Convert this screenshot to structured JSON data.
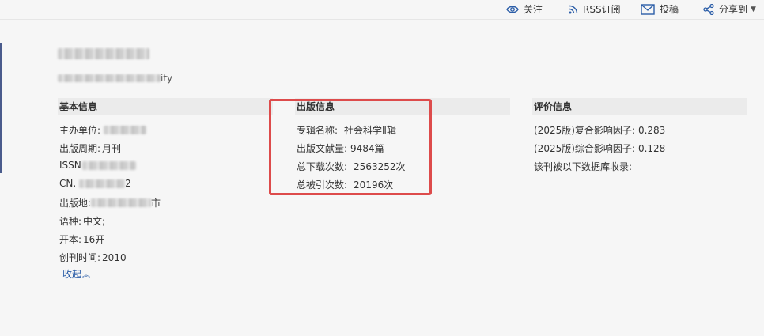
{
  "toolbar": {
    "follow": "关注",
    "rss": "RSS订阅",
    "submit": "投稿",
    "share": "分享到"
  },
  "header": {
    "subtitle_suffix": "ity"
  },
  "basic": {
    "heading": "基本信息",
    "sponsor_label": "主办单位:",
    "period_label": "出版周期:",
    "period_value": "月刊",
    "issn_label": "ISSN",
    "cn_label": "CN.",
    "cn_suffix": "2",
    "place_label": "出版地:",
    "place_suffix": "市",
    "language_label": "语种:",
    "language_value": "中文;",
    "format_label": "开本:",
    "format_value": "16开",
    "founded_label": "创刊时间:",
    "founded_value": "2010",
    "collapse_label": "收起"
  },
  "publication": {
    "heading": "出版信息",
    "album_label": "专辑名称:",
    "album_value": "社会科学Ⅱ辑",
    "articles_label": "出版文献量:",
    "articles_value": "9484篇",
    "downloads_label": "总下载次数:",
    "downloads_value": "2563252次",
    "citations_label": "总被引次数:",
    "citations_value": "20196次"
  },
  "evaluation": {
    "heading": "评价信息",
    "composite_label": "(2025版)复合影响因子:",
    "composite_value": "0.283",
    "comprehensive_label": "(2025版)综合影响因子:",
    "comprehensive_value": "0.128",
    "database_label": "该刊被以下数据库收录:"
  },
  "colors": {
    "highlight": "#dd4b4b",
    "link": "#2c5ea8",
    "icon": "#2c5ea8"
  }
}
